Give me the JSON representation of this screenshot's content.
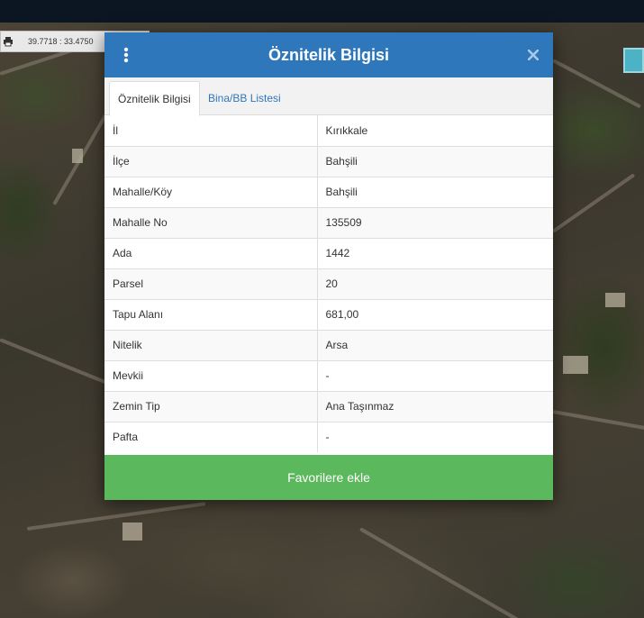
{
  "map": {
    "coordinates": "39.7718 : 33.4750"
  },
  "dialog": {
    "title": "Öznitelik Bilgisi",
    "tabs": [
      {
        "label": "Öznitelik Bilgisi",
        "active": true
      },
      {
        "label": "Bina/BB Listesi",
        "active": false
      }
    ],
    "rows": [
      {
        "label": "İl",
        "value": "Kırıkkale"
      },
      {
        "label": "İlçe",
        "value": "Bahşili"
      },
      {
        "label": "Mahalle/Köy",
        "value": "Bahşili"
      },
      {
        "label": "Mahalle No",
        "value": "135509"
      },
      {
        "label": "Ada",
        "value": "1442"
      },
      {
        "label": "Parsel",
        "value": "20"
      },
      {
        "label": "Tapu Alanı",
        "value": "681,00"
      },
      {
        "label": "Nitelik",
        "value": "Arsa"
      },
      {
        "label": "Mevkii",
        "value": "-"
      },
      {
        "label": "Zemin Tip",
        "value": "Ana Taşınmaz"
      },
      {
        "label": "Pafta",
        "value": "-"
      }
    ],
    "favorite_button": "Favorilere ekle"
  },
  "icons": {
    "menu": "vertical-dots-icon",
    "close": "close-icon",
    "print": "print-icon"
  },
  "colors": {
    "header": "#2f77bb",
    "favorite_button": "#5cb85c",
    "topbar": "#0b1622"
  }
}
